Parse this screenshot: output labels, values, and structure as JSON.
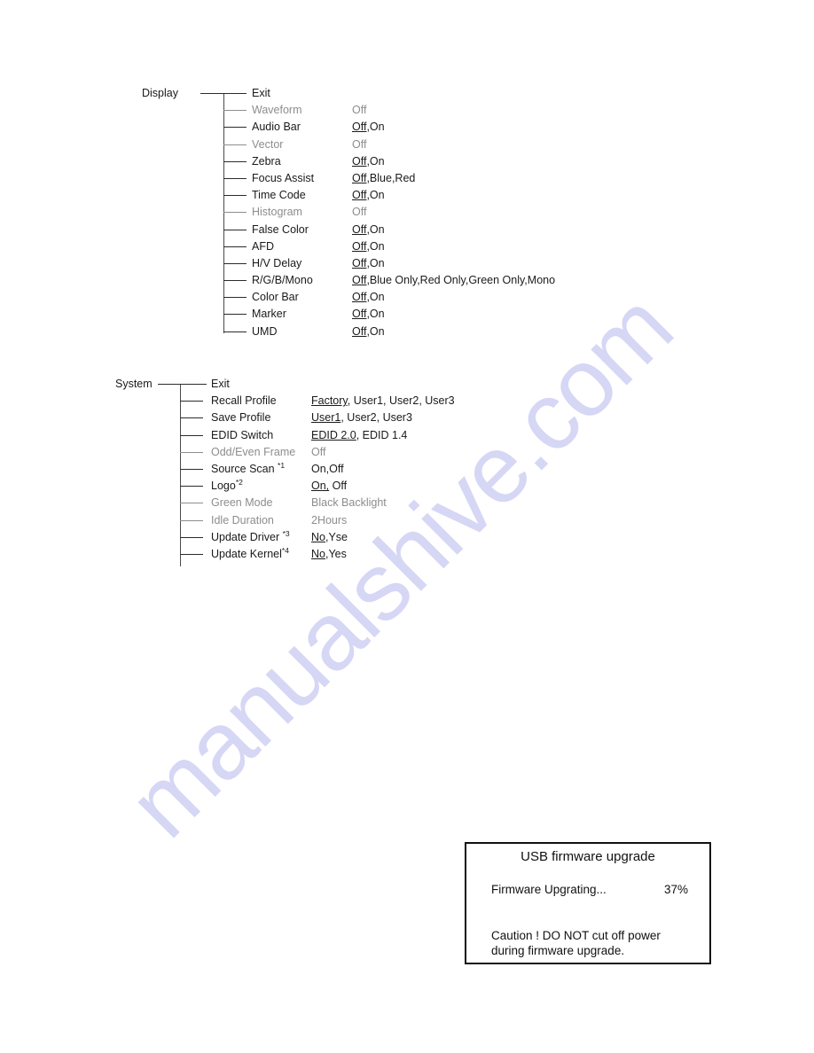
{
  "watermark": {
    "text": "manualshive.com",
    "color": "#d6d6f5"
  },
  "display_menu": {
    "root_label": "Display",
    "items": [
      {
        "label": "Exit",
        "value": "",
        "dim": false,
        "underline": ""
      },
      {
        "label": "Waveform",
        "value": "Off",
        "dim": true,
        "underline": ""
      },
      {
        "label": "Audio Bar",
        "value": "Off,On",
        "dim": false,
        "underline": "Off"
      },
      {
        "label": "Vector",
        "value": "Off",
        "dim": true,
        "underline": ""
      },
      {
        "label": "Zebra",
        "value": "Off,On",
        "dim": false,
        "underline": "Off"
      },
      {
        "label": "Focus Assist",
        "value": "Off,Blue,Red",
        "dim": false,
        "underline": "Off"
      },
      {
        "label": "Time Code",
        "value": "Off,On",
        "dim": false,
        "underline": "Off"
      },
      {
        "label": "Histogram",
        "value": "Off",
        "dim": true,
        "underline": ""
      },
      {
        "label": "False Color",
        "value": "Off,On",
        "dim": false,
        "underline": "Off"
      },
      {
        "label": "AFD",
        "value": "Off,On",
        "dim": false,
        "underline": "Off"
      },
      {
        "label": "H/V Delay",
        "value": "Off,On",
        "dim": false,
        "underline": "Off"
      },
      {
        "label": "R/G/B/Mono",
        "value": "Off,Blue Only,Red Only,Green Only,Mono",
        "dim": false,
        "underline": "Off"
      },
      {
        "label": "Color Bar",
        "value": "Off,On",
        "dim": false,
        "underline": "Off"
      },
      {
        "label": "Marker",
        "value": "Off,On",
        "dim": false,
        "underline": "Off"
      },
      {
        "label": "UMD",
        "value": "Off,On",
        "dim": false,
        "underline": "Off"
      }
    ]
  },
  "system_menu": {
    "root_label": "System",
    "items": [
      {
        "label": "Exit",
        "sup": "",
        "value": "",
        "dim": false,
        "underline": ""
      },
      {
        "label": "Recall Profile",
        "sup": "",
        "value": "Factory, User1, User2, User3",
        "dim": false,
        "underline": "Factory"
      },
      {
        "label": "Save Profile",
        "sup": "",
        "value": "User1, User2, User3",
        "dim": false,
        "underline": "User1"
      },
      {
        "label": "EDID Switch",
        "sup": "",
        "value": "EDID 2.0, EDID 1.4",
        "dim": false,
        "underline": "EDID 2.0"
      },
      {
        "label": "Odd/Even Frame",
        "sup": "",
        "value": "Off",
        "dim": true,
        "underline": ""
      },
      {
        "label": "Source Scan ",
        "sup": "*1",
        "value": "On,Off",
        "dim": false,
        "underline": ""
      },
      {
        "label": "Logo",
        "sup": "*2",
        "value": "On, Off",
        "dim": false,
        "underline": "On,"
      },
      {
        "label": "Green Mode",
        "sup": "",
        "value": "Black Backlight",
        "dim": true,
        "underline": ""
      },
      {
        "label": "Idle Duration",
        "sup": "",
        "value": "2Hours",
        "dim": true,
        "underline": ""
      },
      {
        "label": "Update Driver ",
        "sup": "*3",
        "value": "No,Yse",
        "dim": false,
        "underline": "No"
      },
      {
        "label": "Update Kernel",
        "sup": "*4",
        "value": "No,Yes",
        "dim": false,
        "underline": "No"
      }
    ]
  },
  "firmware_dialog": {
    "title": "USB firmware upgrade",
    "progress_label": "Firmware Upgrating...",
    "progress_percent": "37%",
    "caution_line1": "Caution !  DO NOT cut off power",
    "caution_line2": "during firmware upgrade."
  }
}
